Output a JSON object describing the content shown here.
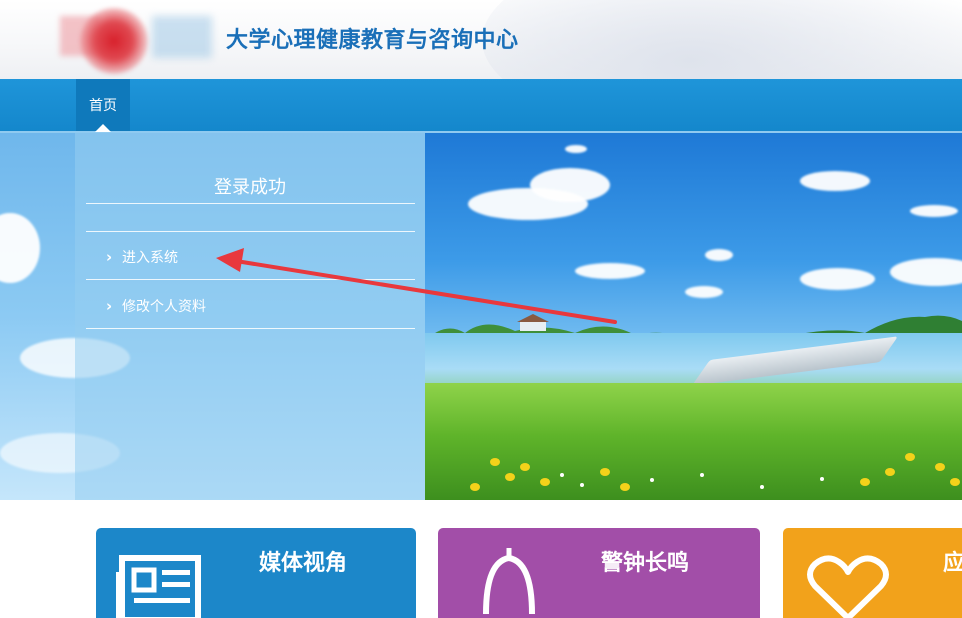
{
  "header": {
    "site_title": "大学心理健康教育与咨询中心"
  },
  "nav": {
    "items": [
      {
        "label": "首页"
      }
    ]
  },
  "login_panel": {
    "title": "登录成功",
    "links": [
      {
        "label": "进入系统"
      },
      {
        "label": "修改个人资料"
      }
    ]
  },
  "tiles": [
    {
      "label": "媒体视角",
      "color": "#1c87c9",
      "icon": "newspaper-icon"
    },
    {
      "label": "警钟长鸣",
      "color": "#a24ea8",
      "icon": "bell-icon"
    },
    {
      "label": "应",
      "color": "#f2a21b",
      "icon": "heart-icon"
    }
  ],
  "colors": {
    "nav_bg": "#1487cc",
    "title_blue": "#1a6fb8",
    "annotation_red": "#e8383d"
  }
}
